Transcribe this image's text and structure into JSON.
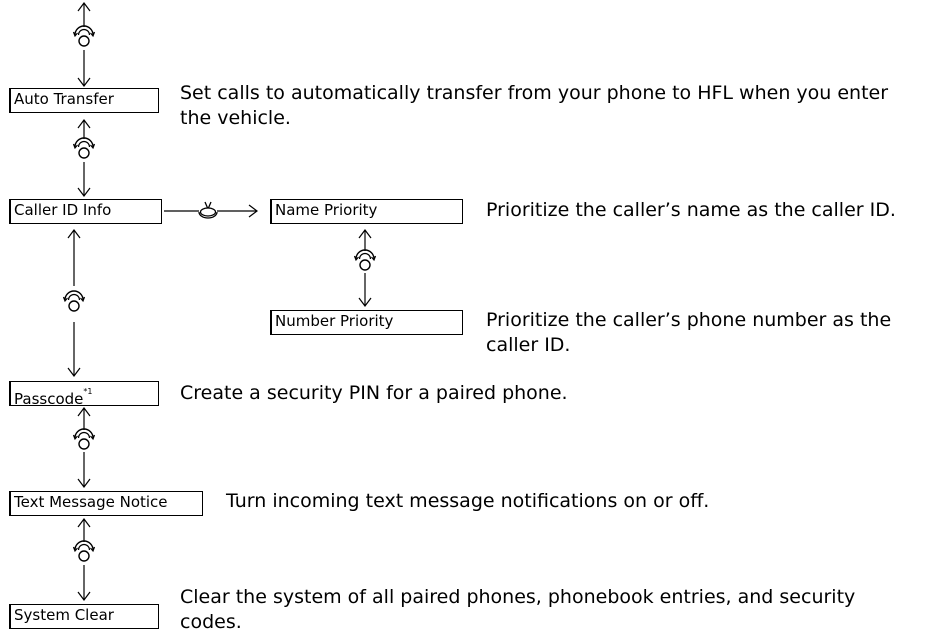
{
  "items": {
    "auto_transfer": {
      "label": "Auto Transfer",
      "desc": "Set calls to automatically transfer from your phone to HFL when you enter the vehicle."
    },
    "caller_id_info": {
      "label": "Caller ID Info"
    },
    "name_priority": {
      "label": "Name Priority",
      "desc": "Prioritize the caller’s name as the caller ID."
    },
    "number_priority": {
      "label": "Number Priority",
      "desc": "Prioritize the caller’s phone number as the caller ID."
    },
    "passcode": {
      "label": "Passcode",
      "footnote": "*1",
      "desc": "Create a security PIN for a paired phone."
    },
    "text_message_notice": {
      "label": "Text Message Notice",
      "desc": "Turn incoming text message notifications on or off."
    },
    "system_clear": {
      "label": "System Clear",
      "desc": "Clear the system of all paired phones, phonebook entries, and security codes."
    }
  },
  "icons": {
    "rotate": "interface-dial-rotate-icon",
    "select": "interface-dial-press-icon"
  }
}
